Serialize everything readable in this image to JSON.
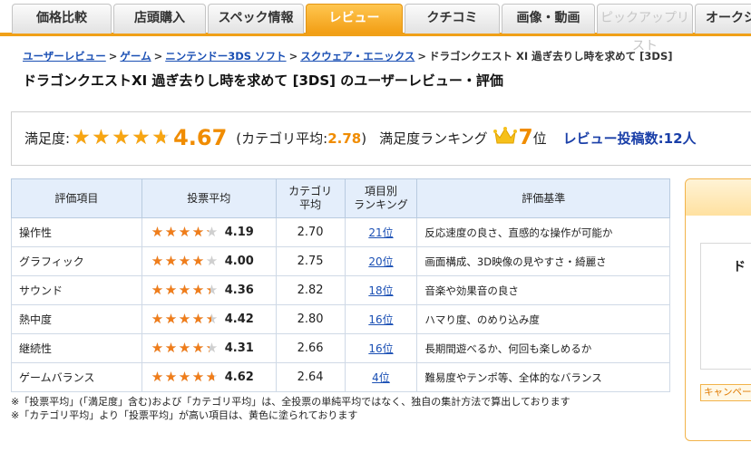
{
  "tabs": [
    {
      "label": "価格比較",
      "state": "normal"
    },
    {
      "label": "店頭購入",
      "state": "normal"
    },
    {
      "label": "スペック情報",
      "state": "normal"
    },
    {
      "label": "レビュー",
      "state": "active"
    },
    {
      "label": "クチコミ",
      "state": "normal"
    },
    {
      "label": "画像・動画",
      "state": "normal"
    },
    {
      "label": "ピックアップリスト",
      "state": "disabled"
    },
    {
      "label": "オークシ",
      "state": "normal"
    }
  ],
  "breadcrumb": {
    "links": [
      "ユーザーレビュー",
      "ゲーム",
      "ニンテンドー3DS ソフト",
      "スクウェア・エニックス"
    ],
    "separator": ">",
    "current": "ドラゴンクエスト XI 過ぎ去りし時を求めて [3DS]"
  },
  "page_title": "ドラゴンクエストXI 過ぎ去りし時を求めて [3DS] のユーザーレビュー・評価",
  "summary": {
    "satisfaction_label": "満足度:",
    "rating": 4.67,
    "score_text": "4.67",
    "category_avg_prefix": "(カテゴリ平均:",
    "category_avg_value": "2.78",
    "category_avg_suffix": ")",
    "ranking_label": "満足度ランキング",
    "rank": "7",
    "rank_unit": "位",
    "review_count": "レビュー投稿数:12人"
  },
  "table": {
    "headers": {
      "item": "評価項目",
      "vote_avg": "投票平均",
      "cat_avg_line1": "カテゴリ",
      "cat_avg_line2": "平均",
      "rank_line1": "項目別",
      "rank_line2": "ランキング",
      "criteria": "評価基準"
    },
    "rows": [
      {
        "item": "操作性",
        "rating": 4.19,
        "vote_avg": "4.19",
        "cat_avg": "2.70",
        "rank": "21位",
        "criteria": "反応速度の良さ、直感的な操作が可能か"
      },
      {
        "item": "グラフィック",
        "rating": 4.0,
        "vote_avg": "4.00",
        "cat_avg": "2.75",
        "rank": "20位",
        "criteria": "画面構成、3D映像の見やすさ・綺麗さ"
      },
      {
        "item": "サウンド",
        "rating": 4.36,
        "vote_avg": "4.36",
        "cat_avg": "2.82",
        "rank": "18位",
        "criteria": "音楽や効果音の良さ"
      },
      {
        "item": "熱中度",
        "rating": 4.42,
        "vote_avg": "4.42",
        "cat_avg": "2.80",
        "rank": "16位",
        "criteria": "ハマり度、のめり込み度"
      },
      {
        "item": "継続性",
        "rating": 4.31,
        "vote_avg": "4.31",
        "cat_avg": "2.66",
        "rank": "16位",
        "criteria": "長期間遊べるか、何回も楽しめるか"
      },
      {
        "item": "ゲームバランス",
        "rating": 4.62,
        "vote_avg": "4.62",
        "cat_avg": "2.64",
        "rank": "4位",
        "criteria": "難易度やテンポ等、全体的なバランス"
      }
    ]
  },
  "notes": [
    "※「投票平均」(「満足度」含む)および「カテゴリ平均」は、全投票の単純平均ではなく、独自の集計方法で算出しております",
    "※「カテゴリ平均」より「投票平均」が高い項目は、黄色に塗られております"
  ],
  "side": {
    "text": "ド",
    "button": "キャンペーン"
  },
  "colors": {
    "accent": "#f0a018",
    "star": "#f7a513",
    "link": "#1a4fb4",
    "header_bg": "#e4eefb"
  }
}
